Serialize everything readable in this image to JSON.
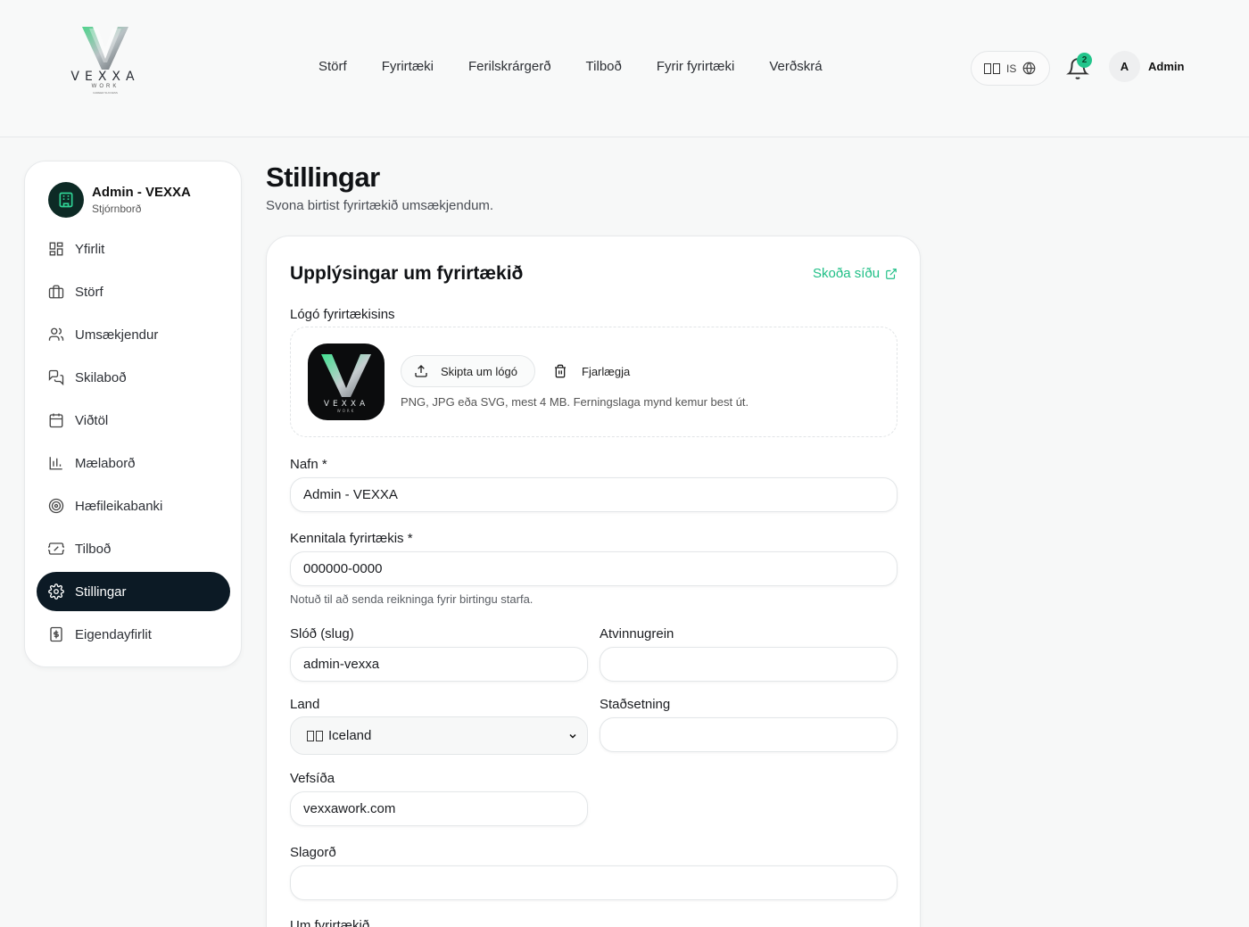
{
  "brand": {
    "word": "VEXXA",
    "sub": "WORK",
    "tagline": "CAREER SUCCESS"
  },
  "nav": [
    "Störf",
    "Fyrirtæki",
    "Ferilskrárgerð",
    "Tilboð",
    "Fyrir fyrirtæki",
    "Verðskrá"
  ],
  "header": {
    "lang": "IS",
    "notifications": "2",
    "avatar_letter": "A",
    "user": "Admin"
  },
  "sidebar": {
    "org_name": "Admin - VEXXA",
    "org_sub": "Stjórnborð",
    "items": [
      {
        "label": "Yfirlit",
        "icon": "grid-icon"
      },
      {
        "label": "Störf",
        "icon": "briefcase-icon"
      },
      {
        "label": "Umsækjendur",
        "icon": "users-icon"
      },
      {
        "label": "Skilaboð",
        "icon": "messages-icon"
      },
      {
        "label": "Viðtöl",
        "icon": "calendar-icon"
      },
      {
        "label": "Mælaborð",
        "icon": "chart-icon"
      },
      {
        "label": "Hæfileikabanki",
        "icon": "target-icon"
      },
      {
        "label": "Tilboð",
        "icon": "ticket-icon"
      },
      {
        "label": "Stillingar",
        "icon": "gear-icon"
      },
      {
        "label": "Eigendayfirlit",
        "icon": "receipt-icon"
      }
    ]
  },
  "page": {
    "title": "Stillingar",
    "subtitle": "Svona birtist fyrirtækið umsækjendum."
  },
  "card": {
    "title": "Upplýsingar um fyrirtækið",
    "view_link": "Skoða síðu",
    "logo_label": "Lógó fyrirtækisins",
    "change_logo": "Skipta um lógó",
    "remove": "Fjarlægja",
    "logo_hint": "PNG, JPG eða SVG, mest 4 MB. Ferningslaga mynd kemur best út.",
    "name_label": "Nafn *",
    "name_value": "Admin - VEXXA",
    "kt_label": "Kennitala fyrirtækis *",
    "kt_value": "000000-0000",
    "kt_hint": "Notuð til að senda reikninga fyrir birtingu starfa.",
    "slug_label": "Slóð (slug)",
    "slug_value": "admin-vexxa",
    "industry_label": "Atvinnugrein",
    "industry_value": "",
    "country_label": "Land",
    "country_value": "Iceland",
    "location_label": "Staðsetning",
    "location_value": "",
    "website_label": "Vefsíða",
    "website_value": "vexxawork.com",
    "slogan_label": "Slagorð",
    "slogan_value": "",
    "about_label": "Um fyrirtækið"
  },
  "colors": {
    "accent": "#1fbf86",
    "active": "#0c1a25",
    "badge": "#22c58b"
  }
}
